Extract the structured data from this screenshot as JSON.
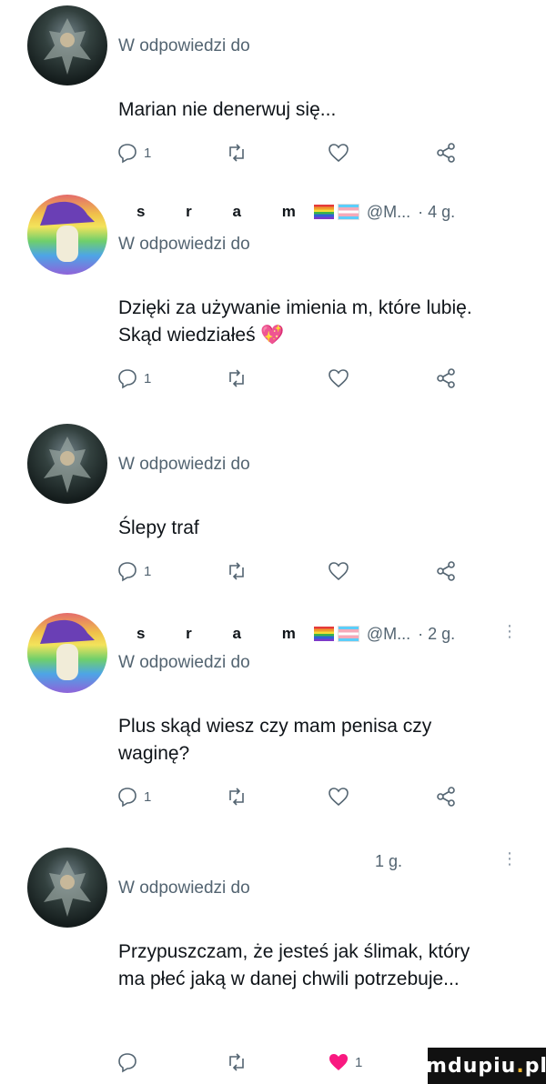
{
  "tweets": [
    {
      "avatar": "dark-fantasy-warrior-avatar",
      "header_name": "",
      "header_handle": "",
      "header_time": "",
      "reply_to": "W odpowiedzi do",
      "text": "Marian nie denerwuj się...",
      "reply_count": "1",
      "like_count": "",
      "liked": false
    },
    {
      "avatar": "rainbow-wizard-hat-avatar",
      "header_name": "s r a m",
      "header_handle": "@M...",
      "header_time": "· 4 g.",
      "reply_to": "W odpowiedzi do",
      "text": "Dzięki za używanie imienia m, które lubię. Skąd wiedziałeś 💖",
      "reply_count": "1",
      "like_count": "",
      "liked": false
    },
    {
      "avatar": "dark-fantasy-warrior-avatar",
      "header_name": "",
      "header_handle": "",
      "header_time": "",
      "reply_to": "W odpowiedzi do",
      "text": "Ślepy traf",
      "reply_count": "1",
      "like_count": "",
      "liked": false
    },
    {
      "avatar": "rainbow-wizard-hat-avatar",
      "header_name": "s r a m",
      "header_handle": "@M...",
      "header_time": "· 2 g.",
      "reply_to": "W odpowiedzi do",
      "text": "Plus skąd wiesz czy mam penisa czy waginę?",
      "reply_count": "1",
      "like_count": "",
      "liked": false
    },
    {
      "avatar": "dark-fantasy-warrior-avatar",
      "header_name": "",
      "header_handle": "",
      "header_time": "1 g.",
      "reply_to": "W odpowiedzi do",
      "text": "Przypuszczam, że jesteś jak ślimak, który ma płeć jaką w danej chwili potrzebuje...",
      "reply_count": "",
      "like_count": "1",
      "liked": true
    }
  ],
  "colors": {
    "text": "#0f1419",
    "muted": "#536471",
    "like_active": "#f91880"
  },
  "watermark": {
    "text_main": "mdupiu",
    "text_dot": ".",
    "text_end": "pl"
  }
}
